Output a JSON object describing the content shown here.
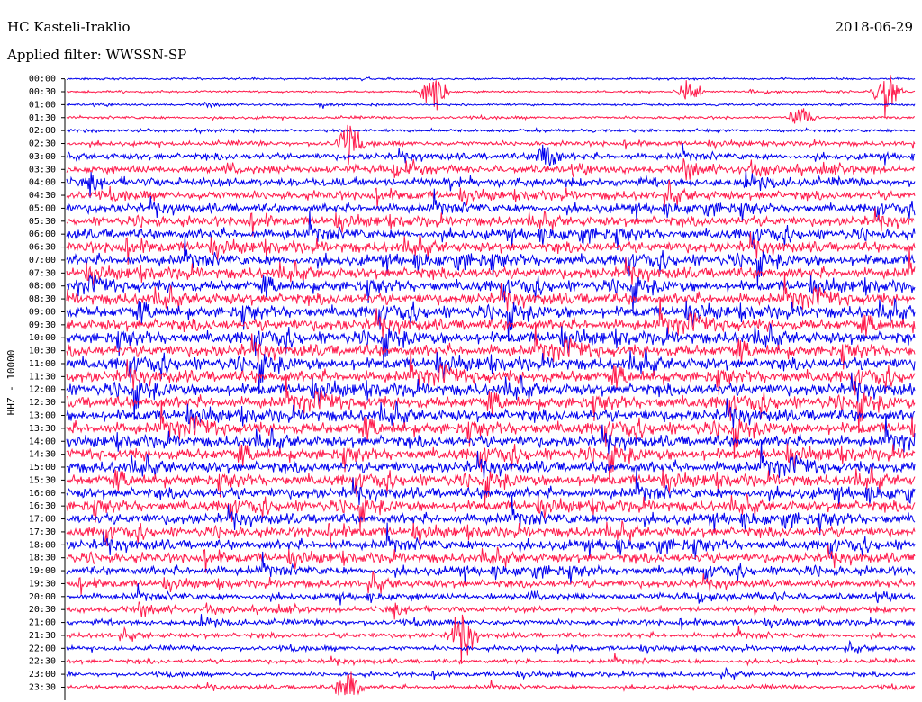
{
  "header": {
    "station": "HC Kasteli-Iraklio",
    "date": "2018-06-29",
    "filter_label": "Applied filter: WWSSN-SP"
  },
  "chart_data": {
    "type": "line",
    "title": "HC Kasteli-Iraklio",
    "ylabel": "HHZ - 10000",
    "y_ticks": [
      "00:00",
      "00:30",
      "01:00",
      "01:30",
      "02:00",
      "02:30",
      "03:00",
      "03:30",
      "04:00",
      "04:30",
      "05:00",
      "05:30",
      "06:00",
      "06:30",
      "07:00",
      "07:30",
      "08:00",
      "08:30",
      "09:00",
      "09:30",
      "10:00",
      "10:30",
      "11:00",
      "11:30",
      "12:00",
      "12:30",
      "13:00",
      "13:30",
      "14:00",
      "14:30",
      "15:00",
      "15:30",
      "16:00",
      "16:30",
      "17:00",
      "17:30",
      "18:00",
      "18:30",
      "19:00",
      "19:30",
      "20:00",
      "20:30",
      "21:00",
      "21:30",
      "22:00",
      "22:30",
      "23:00",
      "23:30"
    ],
    "trace_colors": [
      "#0000ee",
      "#ff1a4b"
    ],
    "activity_level": [
      0.06,
      0.06,
      0.09,
      0.13,
      0.18,
      0.32,
      0.5,
      0.62,
      0.68,
      0.7,
      0.72,
      0.78,
      0.85,
      0.88,
      0.9,
      0.9,
      0.92,
      0.95,
      0.97,
      0.97,
      1.0,
      1.0,
      1.0,
      1.0,
      1.0,
      1.0,
      1.0,
      1.0,
      0.97,
      0.95,
      0.95,
      0.92,
      0.9,
      0.88,
      0.85,
      0.82,
      0.8,
      0.78,
      0.7,
      0.6,
      0.5,
      0.45,
      0.4,
      0.35,
      0.32,
      0.3,
      0.28,
      0.26
    ],
    "notable_events": [
      {
        "trace": "00:30",
        "minute": 13,
        "strength": 3.5
      },
      {
        "trace": "00:30",
        "minute": 22,
        "strength": 1.5
      },
      {
        "trace": "00:30",
        "minute": 29,
        "strength": 3.0
      },
      {
        "trace": "01:30",
        "minute": 26,
        "strength": 1.6
      },
      {
        "trace": "02:30",
        "minute": 10,
        "strength": 2.0
      },
      {
        "trace": "03:00",
        "minute": 17,
        "strength": 2.0
      },
      {
        "trace": "21:30",
        "minute": 14,
        "strength": 3.0
      },
      {
        "trace": "23:30",
        "minute": 10,
        "strength": 2.4
      }
    ]
  }
}
